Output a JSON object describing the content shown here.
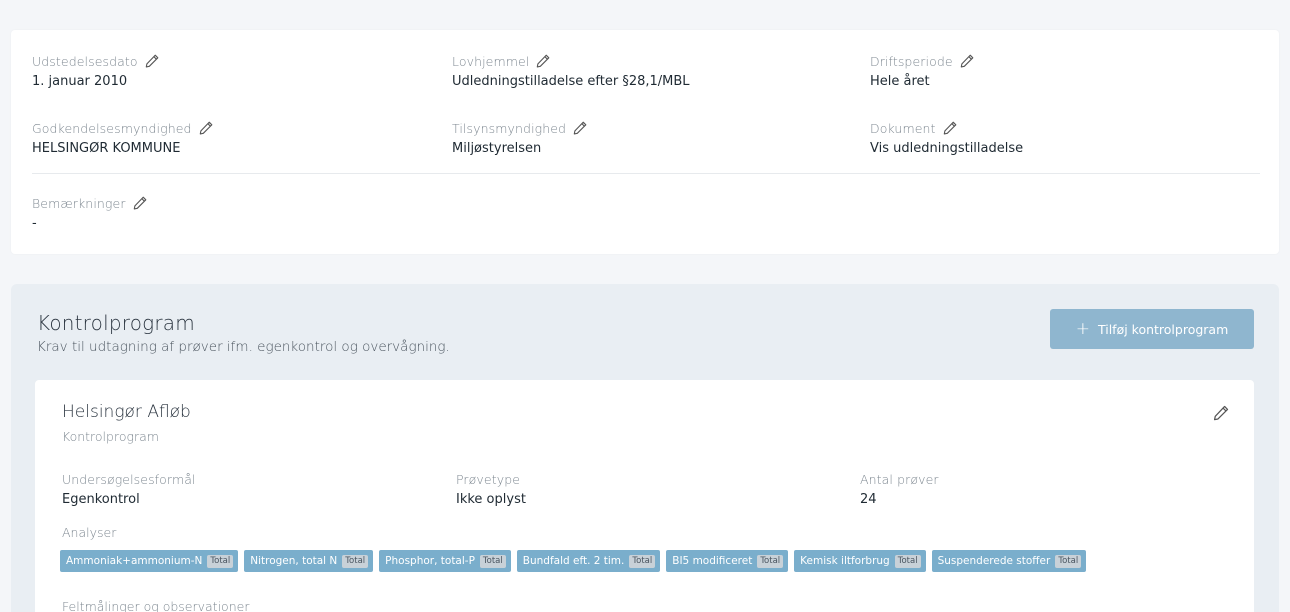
{
  "info": {
    "udstedelsesdato": {
      "label": "Udstedelsesdato",
      "value": "1. januar 2010"
    },
    "lovhjemmel": {
      "label": "Lovhjemmel",
      "value": "Udledningstilladelse efter §28,1/MBL"
    },
    "driftsperiode": {
      "label": "Driftsperiode",
      "value": "Hele året"
    },
    "godkendelsesmyndighed": {
      "label": "Godkendelsesmyndighed",
      "value": "HELSINGØR KOMMUNE"
    },
    "tilsynsmyndighed": {
      "label": "Tilsynsmyndighed",
      "value": "Miljøstyrelsen"
    },
    "dokument": {
      "label": "Dokument",
      "value": "Vis udledningstilladelse"
    },
    "bemaerkninger": {
      "label": "Bemærkninger",
      "value": "-"
    }
  },
  "kontrolprogram": {
    "title": "Kontrolprogram",
    "subtitle": "Krav til udtagning af prøver ifm. egenkontrol og overvågning.",
    "add_button": "Tilføj kontrolprogram",
    "program": {
      "name": "Helsingør Afløb",
      "type_label": "Kontrolprogram",
      "formaal": {
        "label": "Undersøgelsesformål",
        "value": "Egenkontrol"
      },
      "provetype": {
        "label": "Prøvetype",
        "value": "Ikke oplyst"
      },
      "antal": {
        "label": "Antal prøver",
        "value": "24"
      },
      "analyser_label": "Analyser",
      "analyser": [
        {
          "name": "Ammoniak+ammonium-N",
          "badge": "Total"
        },
        {
          "name": "Nitrogen, total N",
          "badge": "Total"
        },
        {
          "name": "Phosphor, total-P",
          "badge": "Total"
        },
        {
          "name": "Bundfald eft. 2 tim.",
          "badge": "Total"
        },
        {
          "name": "BI5 modificeret",
          "badge": "Total"
        },
        {
          "name": "Kemisk iltforbrug",
          "badge": "Total"
        },
        {
          "name": "Suspenderede stoffer",
          "badge": "Total"
        }
      ],
      "next_label": "Feltmålinger og observationer"
    }
  },
  "colors": {
    "accent": "#8fb6cf",
    "tag": "#7aaecc",
    "section_bg": "#e9eef3"
  },
  "icons": {
    "edit": "pencil-icon",
    "add": "plus-icon"
  }
}
